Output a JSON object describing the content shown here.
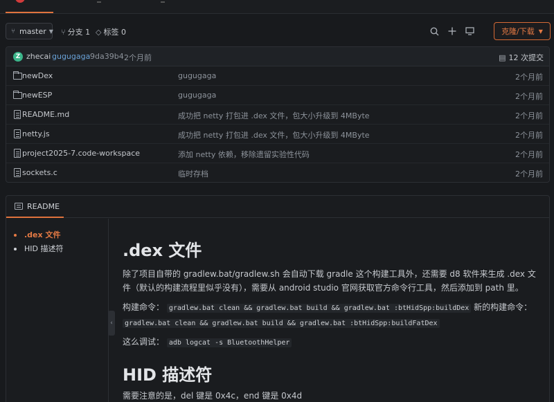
{
  "branch_bar": {
    "branch": "master",
    "branches_label": "分支 1",
    "tags_label": "标签 0",
    "clone_label": "克隆/下载"
  },
  "commit": {
    "avatar_letter": "Z",
    "author": "zhecai",
    "message": "gugugaga",
    "hash": "9da39b4",
    "time": "2个月前",
    "commits_label": "12 次提交"
  },
  "files": [
    {
      "type": "folder",
      "name": "newDex",
      "message": "gugugaga",
      "time": "2个月前"
    },
    {
      "type": "folder",
      "name": "newESP",
      "message": "gugugaga",
      "time": "2个月前"
    },
    {
      "type": "file",
      "name": "README.md",
      "message": "成功把 netty 打包进 .dex 文件，包大小升级到 4MByte",
      "time": "2个月前"
    },
    {
      "type": "file",
      "name": "netty.js",
      "message": "成功把 netty 打包进 .dex 文件，包大小升级到 4MByte",
      "time": "2个月前"
    },
    {
      "type": "file",
      "name": "project2025-7.code-workspace",
      "message": "添加 netty 依赖，移除遗留实验性代码",
      "time": "2个月前"
    },
    {
      "type": "file",
      "name": "sockets.c",
      "message": "临时存档",
      "time": "2个月前"
    }
  ],
  "readme": {
    "tab_label": "README",
    "toc": [
      ".dex 文件",
      "HID 描述符"
    ],
    "h1": ".dex 文件",
    "p1": "除了项目自带的 gradlew.bat/gradlew.sh 会自动下载 gradle 这个构建工具外，还需要 d8 软件来生成 .dex 文件（默认的构建流程里似乎没有），需要从 android studio 官网获取官方命令行工具，然后添加到 path 里。",
    "build_label": "构建命令：",
    "build_cmd": "gradlew.bat clean && gradlew.bat build && gradlew.bat :btHidSpp:buildDex",
    "new_build_label": "新的构建命令：",
    "new_build_cmd": "gradlew.bat clean && gradlew.bat build && gradlew.bat :btHidSpp:buildFatDex",
    "debug_label": "这么调试：",
    "debug_cmd": "adb logcat -s BluetoothHelper",
    "h2": "HID 描述符",
    "p2": "需要注意的是，del 键是 0x4c，end 键是 0x4d"
  }
}
